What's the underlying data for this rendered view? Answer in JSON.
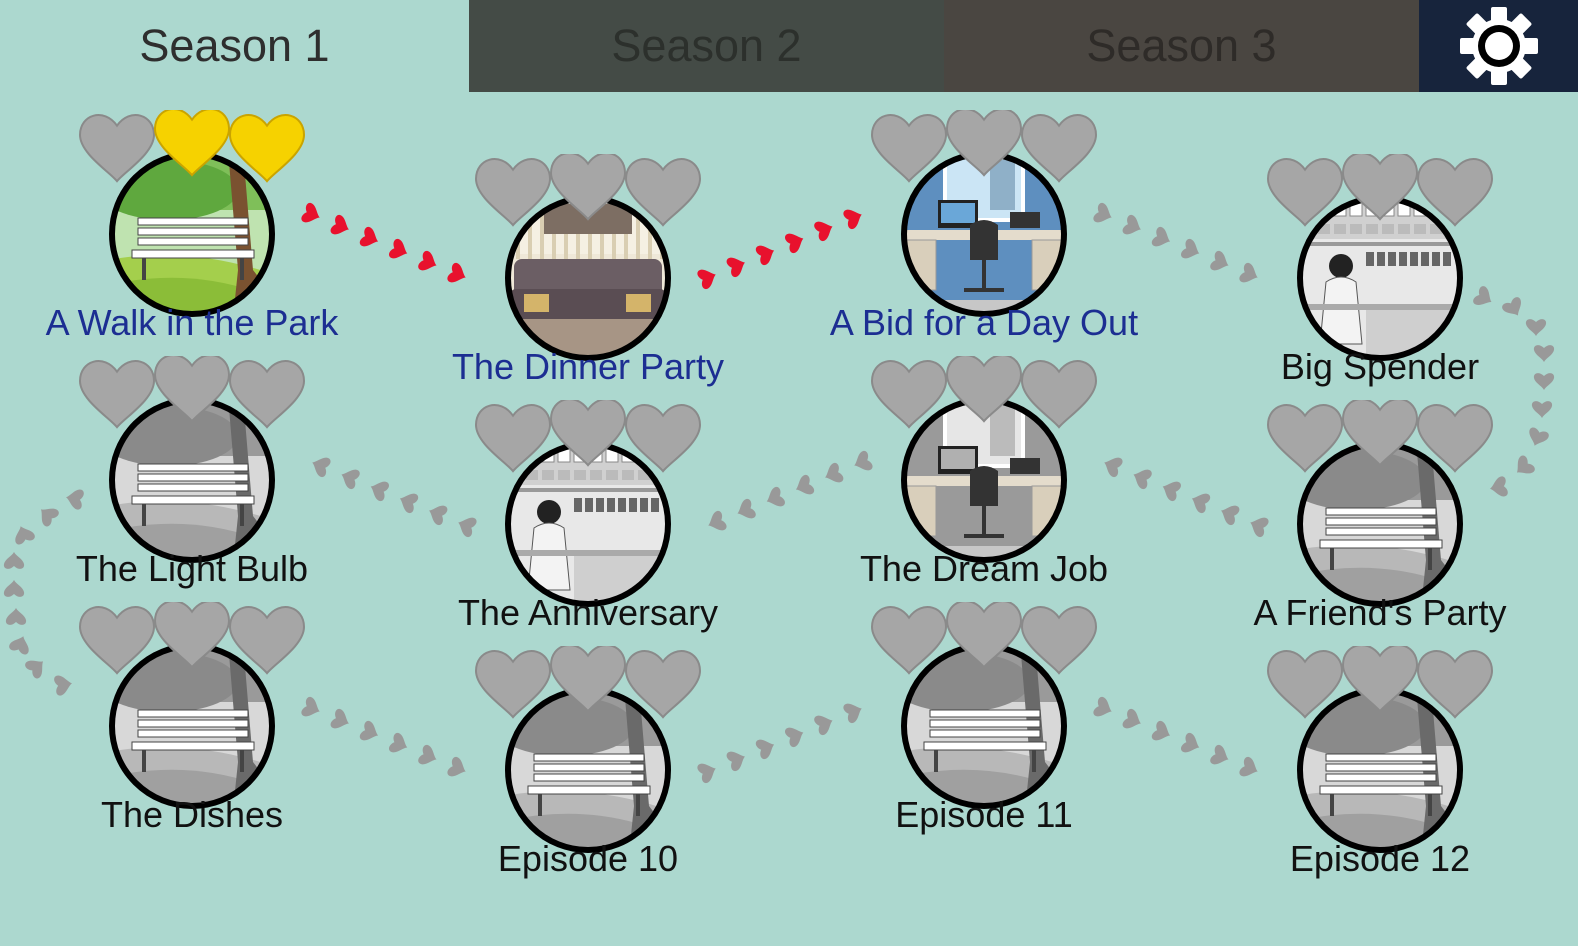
{
  "tabs": [
    {
      "label": "Season 1",
      "active": true
    },
    {
      "label": "Season 2",
      "active": false
    },
    {
      "label": "Season 3",
      "active": false
    }
  ],
  "settings_icon": "gear-icon",
  "colors": {
    "background": "#acd8cf",
    "tab_season2": "#444b46",
    "tab_season3": "#4a4641",
    "settings_bg": "#17243c",
    "unlocked_label": "#1c2e92",
    "locked_label": "#111111",
    "heart_gold": "#f6d200",
    "heart_grey": "#a6a6a6",
    "path_red": "#e8112d",
    "path_grey": "#999999"
  },
  "episodes": [
    {
      "title": "A Walk in the Park",
      "scene": "park",
      "unlocked": true,
      "hearts_earned": 2,
      "hearts_total": 3
    },
    {
      "title": "The Dinner Party",
      "scene": "sofa",
      "unlocked": true,
      "hearts_earned": 0,
      "hearts_total": 3
    },
    {
      "title": "A Bid for a Day Out",
      "scene": "office",
      "unlocked": true,
      "hearts_earned": 0,
      "hearts_total": 3
    },
    {
      "title": "Big Spender",
      "scene": "shop",
      "unlocked": false,
      "hearts_earned": 0,
      "hearts_total": 3
    },
    {
      "title": "The Light Bulb",
      "scene": "park",
      "unlocked": false,
      "hearts_earned": 0,
      "hearts_total": 3
    },
    {
      "title": "The Anniversary",
      "scene": "shop",
      "unlocked": false,
      "hearts_earned": 0,
      "hearts_total": 3
    },
    {
      "title": "The Dream Job",
      "scene": "office",
      "unlocked": false,
      "hearts_earned": 0,
      "hearts_total": 3
    },
    {
      "title": "A Friend's Party",
      "scene": "park",
      "unlocked": false,
      "hearts_earned": 0,
      "hearts_total": 3
    },
    {
      "title": "The Dishes",
      "scene": "park",
      "unlocked": false,
      "hearts_earned": 0,
      "hearts_total": 3
    },
    {
      "title": "Episode 10",
      "scene": "park",
      "unlocked": false,
      "hearts_earned": 0,
      "hearts_total": 3
    },
    {
      "title": "Episode 11",
      "scene": "park",
      "unlocked": false,
      "hearts_earned": 0,
      "hearts_total": 3
    },
    {
      "title": "Episode 12",
      "scene": "park",
      "unlocked": false,
      "hearts_earned": 0,
      "hearts_total": 3
    }
  ]
}
